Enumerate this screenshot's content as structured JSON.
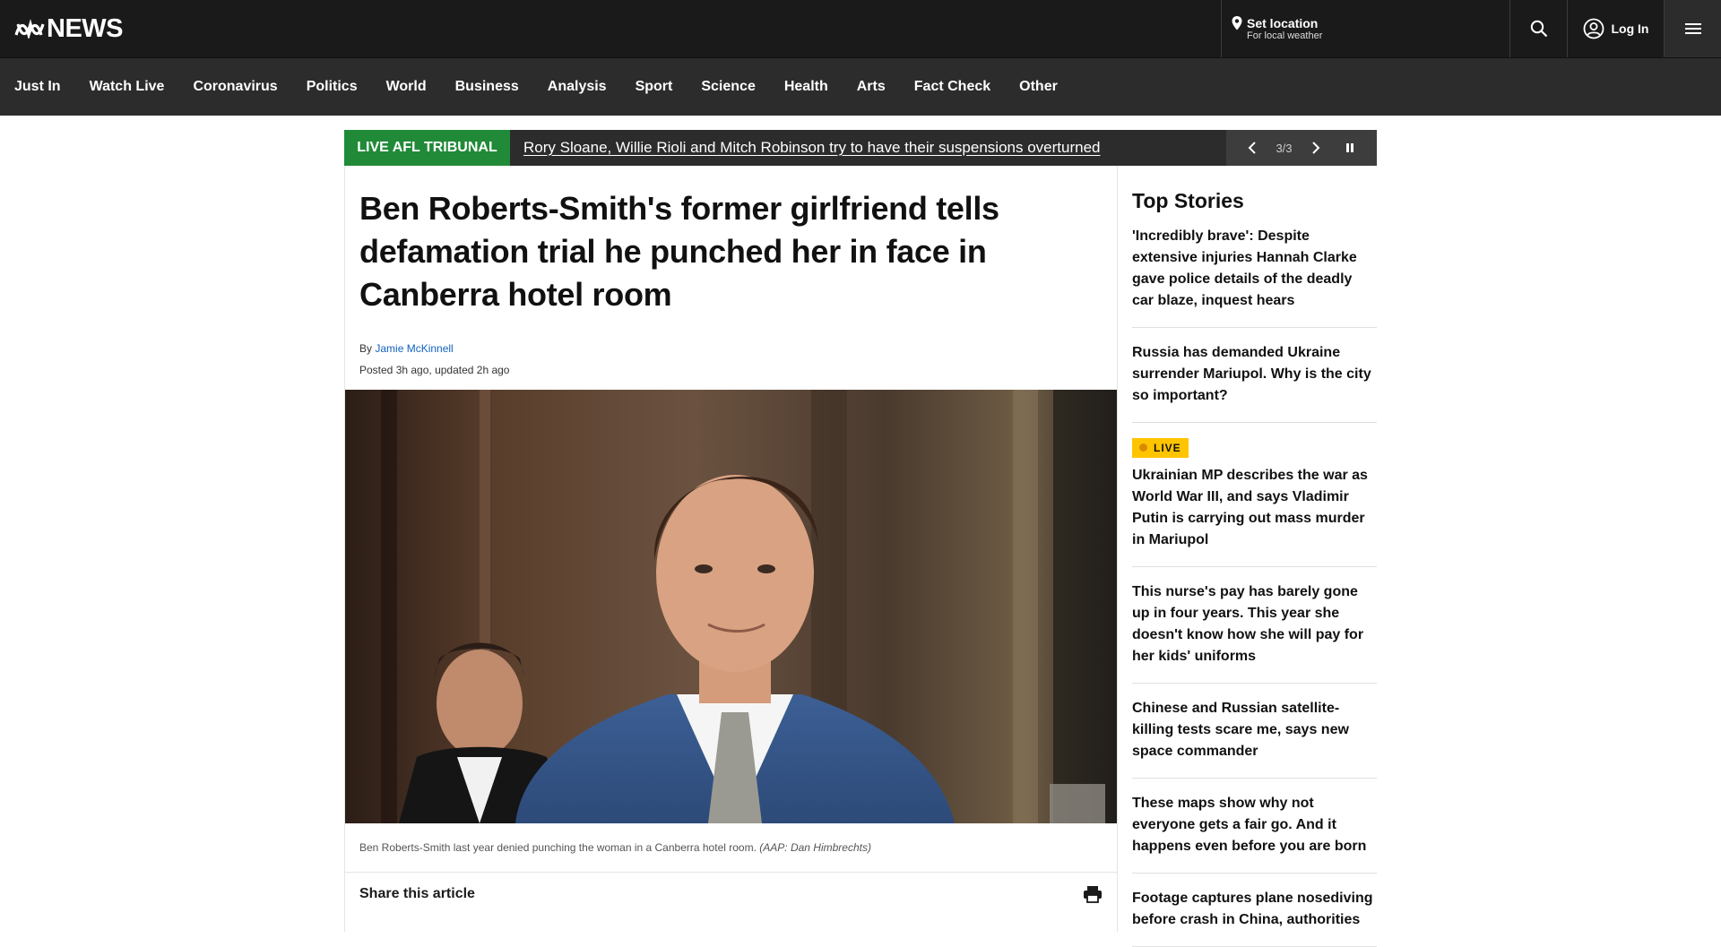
{
  "header": {
    "brand": "NEWS",
    "location_title": "Set location",
    "location_subtitle": "For local weather",
    "login_label": "Log In"
  },
  "nav": {
    "items": [
      "Just In",
      "Watch Live",
      "Coronavirus",
      "Politics",
      "World",
      "Business",
      "Analysis",
      "Sport",
      "Science",
      "Health",
      "Arts",
      "Fact Check",
      "Other"
    ]
  },
  "ticker": {
    "tag": "LIVE AFL TRIBUNAL",
    "text": "Rory Sloane, Willie Rioli and Mitch Robinson try to have their suspensions overturned",
    "count": "3/3"
  },
  "article": {
    "headline": "Ben Roberts-Smith's former girlfriend tells defamation trial he punched her in face in Canberra hotel room",
    "by_prefix": "By",
    "author": "Jamie McKinnell",
    "posted": "Posted 3h ago, updated 2h ago",
    "caption": "Ben Roberts-Smith last year denied punching the woman in a Canberra hotel room.",
    "credit": "(AAP: Dan Himbrechts)",
    "share_label": "Share this article"
  },
  "sidebar": {
    "title": "Top Stories",
    "live_badge": "LIVE",
    "stories": [
      "'Incredibly brave': Despite extensive injuries Hannah Clarke gave police details of the deadly car blaze, inquest hears",
      "Russia has demanded Ukraine surrender Mariupol. Why is the city so important?",
      "Ukrainian MP describes the war as World War III, and says Vladimir Putin is carrying out mass murder in Mariupol",
      "This nurse's pay has barely gone up in four years. This year she doesn't know how she will pay for her kids' uniforms",
      "Chinese and Russian satellite-killing tests scare me, says new space commander",
      "These maps show why not everyone gets a fair go. And it happens even before you are born",
      "Footage captures plane nosediving before crash in China, authorities"
    ]
  }
}
